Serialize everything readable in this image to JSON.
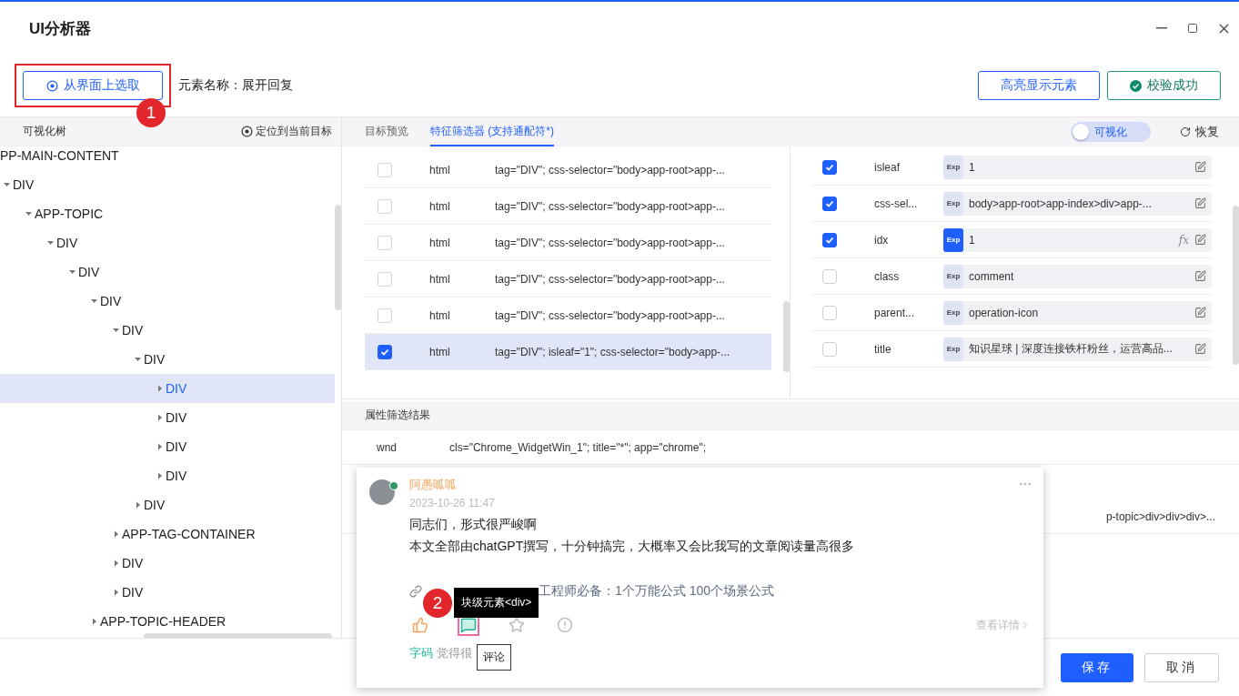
{
  "window": {
    "title": "UI分析器"
  },
  "toolbar": {
    "pick_button": "从界面上选取",
    "marker": "1",
    "element_name": "元素名称：展开回复",
    "highlight_button": "高亮显示元素",
    "verify_button": "校验成功"
  },
  "tree": {
    "title": "可视化树",
    "locate": "定位到当前目标",
    "nodes": [
      {
        "label": "PP-MAIN-CONTENT",
        "selected": false,
        "children": [
          {
            "label": "DIV",
            "expanded": true,
            "selected": false,
            "children": [
              {
                "label": "APP-TOPIC",
                "expanded": true,
                "selected": false,
                "children": [
                  {
                    "label": "DIV",
                    "expanded": true,
                    "selected": false,
                    "children": [
                      {
                        "label": "DIV",
                        "expanded": true,
                        "selected": false,
                        "children": [
                          {
                            "label": "DIV",
                            "expanded": true,
                            "selected": false,
                            "children": [
                              {
                                "label": "DIV",
                                "expanded": true,
                                "selected": false,
                                "children": [
                                  {
                                    "label": "DIV",
                                    "expanded": true,
                                    "selected": false,
                                    "children": [
                                      {
                                        "label": "DIV",
                                        "expanded": false,
                                        "selected": true
                                      },
                                      {
                                        "label": "DIV",
                                        "expanded": false,
                                        "selected": false
                                      },
                                      {
                                        "label": "DIV",
                                        "expanded": false,
                                        "selected": false
                                      },
                                      {
                                        "label": "DIV",
                                        "expanded": false,
                                        "selected": false
                                      }
                                    ]
                                  },
                                  {
                                    "label": "DIV",
                                    "expanded": false,
                                    "selected": false
                                  }
                                ]
                              },
                              {
                                "label": "APP-TAG-CONTAINER",
                                "expanded": false,
                                "selected": false
                              },
                              {
                                "label": "DIV",
                                "expanded": false,
                                "selected": false
                              },
                              {
                                "label": "DIV",
                                "expanded": false,
                                "selected": false
                              }
                            ]
                          },
                          {
                            "label": "APP-TOPIC-HEADER",
                            "expanded": false,
                            "selected": false
                          }
                        ]
                      }
                    ]
                  }
                ]
              }
            ]
          }
        ]
      }
    ]
  },
  "tabs": [
    {
      "label": "目标预览",
      "selected": false
    },
    {
      "label": "特征筛选器 (支持通配符*)",
      "selected": true
    }
  ],
  "visualize_toggle": {
    "label": "可视化",
    "on": true
  },
  "restore": "恢复",
  "candidates": [
    {
      "checked": false,
      "selected": false,
      "type": "html",
      "selector": "tag=\"DIV\"; css-selector=\"body>app-root>app-..."
    },
    {
      "checked": false,
      "selected": false,
      "type": "html",
      "selector": "tag=\"DIV\"; css-selector=\"body>app-root>app-..."
    },
    {
      "checked": false,
      "selected": false,
      "type": "html",
      "selector": "tag=\"DIV\"; css-selector=\"body>app-root>app-..."
    },
    {
      "checked": false,
      "selected": false,
      "type": "html",
      "selector": "tag=\"DIV\"; css-selector=\"body>app-root>app-..."
    },
    {
      "checked": false,
      "selected": false,
      "type": "html",
      "selector": "tag=\"DIV\"; css-selector=\"body>app-root>app-..."
    },
    {
      "checked": true,
      "selected": true,
      "type": "html",
      "selector": "tag=\"DIV\"; isleaf=\"1\"; css-selector=\"body>app-..."
    }
  ],
  "attributes": [
    {
      "checked": true,
      "name": "isleaf",
      "tag": "Exp",
      "tag_active": false,
      "value": "1"
    },
    {
      "checked": true,
      "name": "css-sel...",
      "tag": "Exp",
      "tag_active": false,
      "value": "body>app-root>app-index>div>app-..."
    },
    {
      "checked": true,
      "name": "idx",
      "tag": "Exp",
      "tag_active": true,
      "value": "1",
      "formula": "fx"
    },
    {
      "checked": false,
      "name": "class",
      "tag": "Exp",
      "tag_active": false,
      "value": "comment"
    },
    {
      "checked": false,
      "name": "parent...",
      "tag": "Exp",
      "tag_active": false,
      "value": "operation-icon"
    },
    {
      "checked": false,
      "name": "title",
      "tag": "Exp",
      "tag_active": false,
      "value": "知识星球 | 深度连接铁杆粉丝，运营高品..."
    }
  ],
  "results": {
    "title": "属性筛选结果",
    "rows": [
      {
        "column_1": "wnd",
        "column_2": "cls=\"Chrome_WidgetWin_1\"; title=\"*\"; app=\"chrome\";"
      },
      {
        "column_2": "p-topic>div>div>div>..."
      }
    ]
  },
  "popup": {
    "author": "阿愚呱呱",
    "time": "2023-10-26 11:47",
    "lines": [
      "同志们，形式很严峻啊",
      "本文全部由chatGPT撰写，十分钟搞完，大概率又会比我写的文章阅读量高很多"
    ],
    "link": "工程师必备：1个万能公式 100个场景公式",
    "tooltip": "块级元素<div>",
    "marker": "2",
    "actions": [
      {
        "kind": "like",
        "selected": false
      },
      {
        "kind": "comment",
        "selected": true
      },
      {
        "kind": "star",
        "selected": false
      },
      {
        "kind": "report",
        "selected": false
      }
    ],
    "detail": "查看详情",
    "comment_user": "字码",
    "comment_text": "觉得很",
    "hint": "评论"
  },
  "footer": {
    "save": "保存",
    "cancel": "取消"
  }
}
